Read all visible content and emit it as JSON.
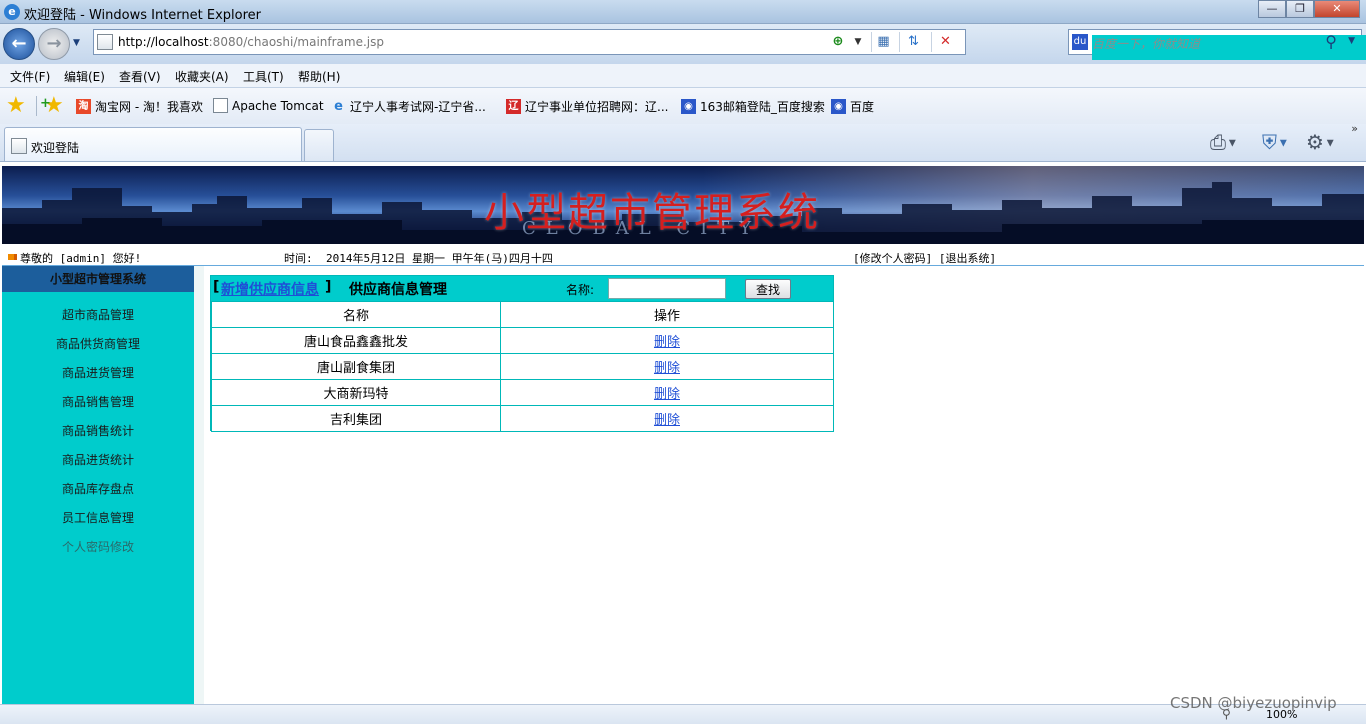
{
  "window": {
    "title": "欢迎登陆 - Windows Internet Explorer"
  },
  "address": {
    "url_host": "http://localhost",
    "url_path": ":8080/chaoshi/mainframe.jsp"
  },
  "search": {
    "placeholder": "百度一下，你就知道"
  },
  "menu": [
    "文件(F)",
    "编辑(E)",
    "查看(V)",
    "收藏夹(A)",
    "工具(T)",
    "帮助(H)"
  ],
  "favorites": [
    {
      "label": "淘宝网 - 淘！我喜欢",
      "icon": "taobao-icon",
      "color": "#e8492a"
    },
    {
      "label": "Apache Tomcat",
      "icon": "page-icon",
      "color": "#7a8793"
    },
    {
      "label": "辽宁人事考试网-辽宁省...",
      "icon": "ie-page-icon",
      "color": "#2d7fd4"
    },
    {
      "label": "辽宁事业单位招聘网：辽...",
      "icon": "zhaopin-icon",
      "color": "#d42a2a"
    },
    {
      "label": "163邮箱登陆_百度搜索",
      "icon": "baidu-icon",
      "color": "#2a57c9"
    },
    {
      "label": "百度",
      "icon": "baidu-icon",
      "color": "#2a57c9"
    }
  ],
  "tab": {
    "label": "欢迎登陆"
  },
  "banner": {
    "title": "小型超市管理系统"
  },
  "infobar": {
    "greeting": "尊敬的 [admin] 您好!",
    "time_label": "时间:",
    "datetime": "2014年5月12日 星期一 甲午年(马)四月十四",
    "links": "[修改个人密码] [退出系统]"
  },
  "sidebar": {
    "header": "小型超市管理系统",
    "items": [
      "超市商品管理",
      "商品供货商管理",
      "商品进货管理",
      "商品销售管理",
      "商品销售统计",
      "商品进货统计",
      "商品库存盘点",
      "员工信息管理",
      "个人密码修改"
    ]
  },
  "panel": {
    "add_link": "新增供应商信息",
    "title": "供应商信息管理",
    "search_label": "名称:",
    "search_value": "",
    "search_button": "查找",
    "columns": [
      "名称",
      "操作"
    ],
    "rows": [
      {
        "name": "唐山食品鑫鑫批发",
        "action": "删除"
      },
      {
        "name": "唐山副食集团",
        "action": "删除"
      },
      {
        "name": "大商新玛特",
        "action": "删除"
      },
      {
        "name": "吉利集团",
        "action": "删除"
      }
    ]
  },
  "status": {
    "zoom": "100%"
  },
  "watermark": "CSDN @biyezuopinvip",
  "colors": {
    "accent": "#00cccc",
    "sidebar_header": "#1c5e9c",
    "link": "#1f4fd6",
    "banner_title": "#d51f1f"
  }
}
